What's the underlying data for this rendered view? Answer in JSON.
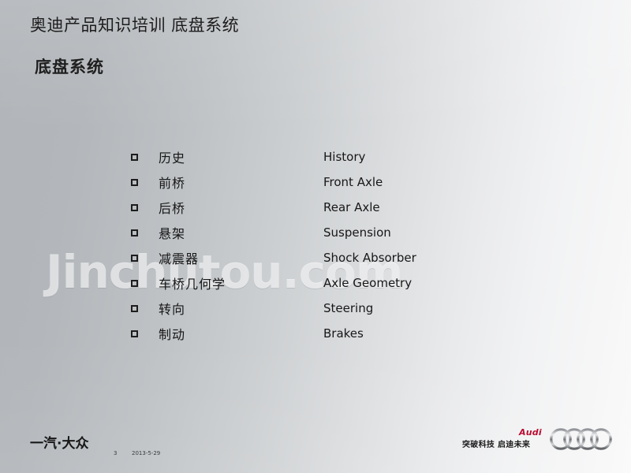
{
  "slide": {
    "title": "奥迪产品知识培训 底盘系统",
    "subtitle": "底盘系统",
    "watermark": "Jinchutou.com"
  },
  "agenda": {
    "items": [
      {
        "cn": "历史",
        "en": "History",
        "bullet": "hollow-square-bullet"
      },
      {
        "cn": "前桥",
        "en": "Front Axle",
        "bullet": "hollow-square-bullet"
      },
      {
        "cn": "后桥",
        "en": "Rear Axle",
        "bullet": "hollow-square-bullet"
      },
      {
        "cn": "悬架",
        "en": "Suspension",
        "bullet": "hollow-square-bullet"
      },
      {
        "cn": "减震器",
        "en": "Shock Absorber",
        "bullet": "hollow-square-bullet"
      },
      {
        "cn": "车桥几何学",
        "en": "Axle Geometry",
        "bullet": "hollow-square-bullet"
      },
      {
        "cn": "转向",
        "en": "Steering",
        "bullet": "hollow-square-bullet"
      },
      {
        "cn": "制动",
        "en": "Brakes",
        "bullet": "hollow-square-bullet"
      }
    ]
  },
  "footer": {
    "faw_logo_text": "一汽·大众",
    "page_number": "3",
    "date": "2013-5-29",
    "audi_wordmark": "Audi",
    "audi_slogan": "突破科技 启迪未来",
    "audi_rings_icon": "audi-four-rings-icon"
  },
  "colors": {
    "audi_red": "#bb0a30",
    "text_dark": "#161616",
    "bg_left": "#b1b5b9",
    "bg_right": "#fafafa"
  }
}
